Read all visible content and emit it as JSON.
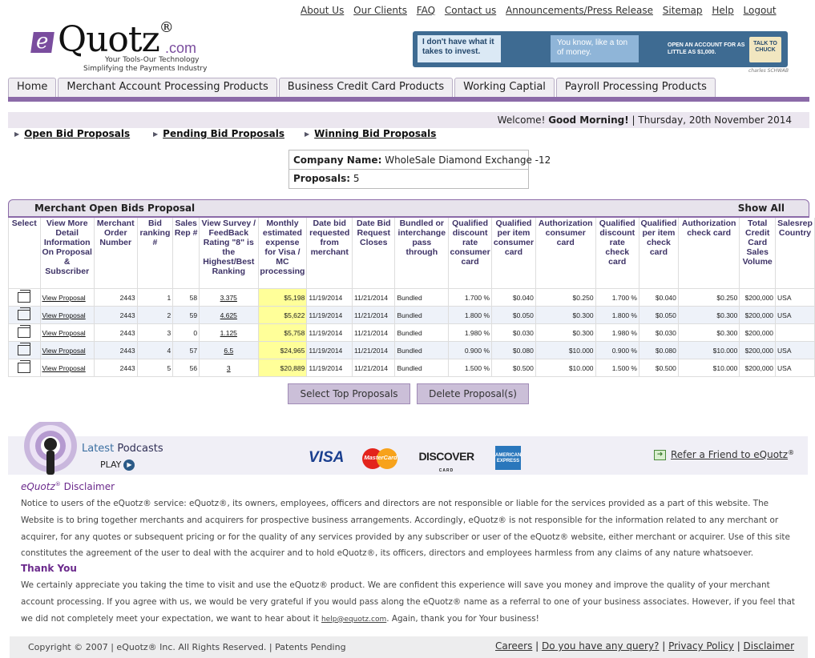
{
  "top_links": [
    "About Us",
    "Our Clients",
    "FAQ",
    "Contact us",
    "Announcements/Press Release",
    "Sitemap",
    "Help",
    "Logout"
  ],
  "logo": {
    "e": "e",
    "name": "Quotz",
    "reg": "®",
    "com": ".com",
    "tagline1": "Your Tools-Our Technology",
    "tagline2": "Simplifying the Payments Industry"
  },
  "banner": {
    "msg1": "I don't have what it takes to invest.",
    "msg2": "You know, like a ton of money.",
    "msg3": "OPEN AN ACCOUNT FOR AS LITTLE AS $1,000.",
    "cta": "TALK TO CHUCK",
    "credit": "charles SCHWAB"
  },
  "nav_tabs": [
    "Home",
    "Merchant Account Processing Products",
    "Business Credit Card Products",
    "Working Captial",
    "Payroll Processing Products"
  ],
  "welcome": {
    "prefix": "Welcome!",
    "greeting": "Good Morning!",
    "sep": "|",
    "date": "Thursday, 20th November 2014"
  },
  "bid_links": [
    "Open Bid Proposals",
    "Pending Bid Proposals",
    "Winning Bid Proposals"
  ],
  "company": {
    "name_label": "Company Name:",
    "name_value": "WholeSale Diamond Exchange -12",
    "proposals_label": "Proposals:",
    "proposals_value": "5"
  },
  "table": {
    "title": "Merchant Open Bids Proposal",
    "show_all": "Show All",
    "headers": [
      "Select",
      "View More Detail Information On Proposal & Subscriber",
      "Merchant Order Number",
      "Bid ranking #",
      "Sales Rep #",
      "View Survey / FeedBack Rating \"8\" is the Highest/Best Ranking",
      "Monthly estimated expense for Visa / MC processing",
      "Date bid requested from merchant",
      "Date Bid Request Closes",
      "Bundled or interchange pass through",
      "Qualified discount rate consumer card",
      "Qualified per item consumer card",
      "Authorization consumer card",
      "Qualified discount rate check card",
      "Qualified per item check card",
      "Authorization check card",
      "Total Credit Card Sales Volume",
      "Salesrep Country"
    ],
    "rows": [
      [
        "",
        "View Proposal",
        "2443",
        "1",
        "58",
        "3.375",
        "$5,198",
        "11/19/2014",
        "11/21/2014",
        "Bundled",
        "1.700 %",
        "$0.040",
        "$0.250",
        "1.700 %",
        "$0.040",
        "$0.250",
        "$200,000",
        "USA"
      ],
      [
        "",
        "View Proposal",
        "2443",
        "2",
        "59",
        "4.625",
        "$5,622",
        "11/19/2014",
        "11/21/2014",
        "Bundled",
        "1.800 %",
        "$0.050",
        "$0.300",
        "1.800 %",
        "$0.050",
        "$0.300",
        "$200,000",
        "USA"
      ],
      [
        "",
        "View Proposal",
        "2443",
        "3",
        "0",
        "1.125",
        "$5,758",
        "11/19/2014",
        "11/21/2014",
        "Bundled",
        "1.980 %",
        "$0.030",
        "$0.300",
        "1.980 %",
        "$0.030",
        "$0.300",
        "$200,000",
        ""
      ],
      [
        "",
        "View Proposal",
        "2443",
        "4",
        "57",
        "6.5",
        "$24,965",
        "11/19/2014",
        "11/21/2014",
        "Bundled",
        "0.900 %",
        "$0.080",
        "$10.000",
        "0.900 %",
        "$0.080",
        "$10.000",
        "$200,000",
        "USA"
      ],
      [
        "",
        "View Proposal",
        "2443",
        "5",
        "56",
        "3",
        "$20,889",
        "11/19/2014",
        "11/21/2014",
        "Bundled",
        "1.500 %",
        "$0.500",
        "$10.000",
        "1.500 %",
        "$0.500",
        "$10.000",
        "$200,000",
        "USA"
      ]
    ]
  },
  "buttons": {
    "select_top": "Select Top Proposals",
    "delete": "Delete Proposal(s)"
  },
  "podcast": {
    "latest": "Latest",
    "podcasts": "Podcasts",
    "play": "PLAY"
  },
  "cards": {
    "visa": "VISA",
    "mastercard": "MasterCard",
    "discover": "DISCOVER",
    "discover_sub": "CARD",
    "amex": "AMERICAN EXPRESS"
  },
  "refer": "Refer a Friend to eQuotz",
  "refer_reg": "®",
  "disclaimer": {
    "title_e": "eQuotz",
    "title_reg": "®",
    "title_rest": " Disclaimer",
    "text": "Notice to users of the eQuotz® service: eQuotz®, its owners, employees, officers and directors are not responsible or liable for the services provided as a part of this website. The Website is to bring together merchants and acquirers for prospective business arrangements. Accordingly, eQuotz® is not responsible for the information related to any merchant or acquirer, for any quotes or subsequent pricing or for the quality of any services provided by any subscriber or user of the eQuotz® website, either merchant or acquirer. Use of this site constitutes the agreement of the user to deal with the acquirer and to hold eQuotz®, its officers, directors and employees harmless from any claims of any nature whatsoever.",
    "thanks_title": "Thank You",
    "thanks_text": "We certainly appreciate you taking the time to visit and use the eQuotz® product. We are confident this experience will save you money and improve the quality of your merchant account processing. If you agree with us, we would be very grateful if you would pass along the eQuotz® name as a referral to one of your business associates. However, if you feel that we did not completely meet your expectation, we want to hear about it",
    "email": "help@equotz.com",
    "thanks_end": ". Again, thank you for Your business!"
  },
  "footer": {
    "copyright": "Copyright © 2007 | eQuotz® Inc. All Rights Reserved.  | Patents Pending",
    "links": [
      "Careers",
      "Do you have any query?",
      "Privacy Policy",
      "Disclaimer"
    ]
  },
  "colors": {
    "accent": "#8b6aa8",
    "highlight": "#ffff99",
    "header_text": "#3d3266"
  }
}
